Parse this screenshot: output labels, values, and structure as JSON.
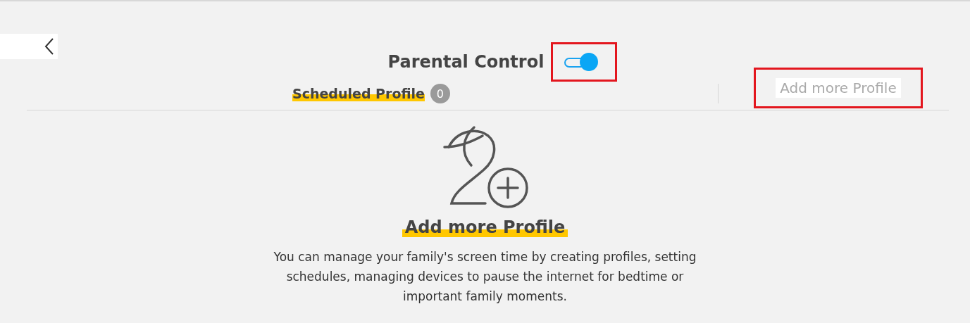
{
  "header": {
    "title": "Parental Control",
    "toggle": {
      "on": true
    }
  },
  "tabs": [
    {
      "label": "Scheduled Profile",
      "count": "0",
      "selected": true
    }
  ],
  "add_link": "Add more Profile",
  "empty_state": {
    "heading": "Add more Profile",
    "description": "You can manage your family's screen time by creating profiles, setting schedules, managing devices to pause the internet for bedtime or important family moments."
  }
}
